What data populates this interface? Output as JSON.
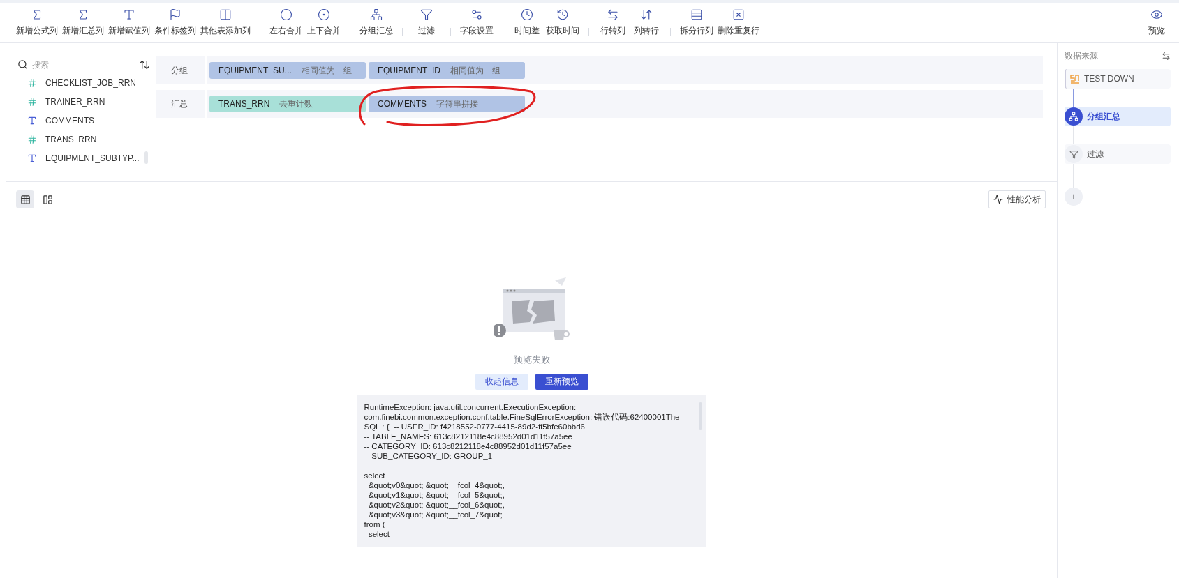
{
  "toolbar": {
    "groups": [
      [
        {
          "label": "新增公式列"
        },
        {
          "label": "新增汇总列"
        },
        {
          "label": "新增赋值列"
        },
        {
          "label": "条件标签列"
        },
        {
          "label": "其他表添加列"
        }
      ],
      [
        {
          "label": "左右合并"
        },
        {
          "label": "上下合并"
        }
      ],
      [
        {
          "label": "分组汇总"
        }
      ],
      [
        {
          "label": "过滤"
        }
      ],
      [
        {
          "label": "字段设置"
        }
      ],
      [
        {
          "label": "时间差"
        },
        {
          "label": "获取时间"
        }
      ],
      [
        {
          "label": "行转列"
        },
        {
          "label": "列转行"
        }
      ],
      [
        {
          "label": "拆分行列"
        },
        {
          "label": "删除重复行"
        }
      ]
    ],
    "preview": {
      "label": "预览"
    }
  },
  "fields": {
    "search": {
      "placeholder": "搜索"
    },
    "items": [
      {
        "name": "CHECKLIST_JOB_RRN",
        "kind": "number"
      },
      {
        "name": "TRAINER_RRN",
        "kind": "number"
      },
      {
        "name": "COMMENTS",
        "kind": "text"
      },
      {
        "name": "TRANS_RRN",
        "kind": "number"
      },
      {
        "name": "EQUIPMENT_SUBTYP...",
        "kind": "text"
      }
    ]
  },
  "config": [
    {
      "label": "分组",
      "tags": [
        {
          "field": "EQUIPMENT_SU...",
          "method": "相同值为一组",
          "color": "#b0c3e5"
        },
        {
          "field": "EQUIPMENT_ID",
          "method": "相同值为一组",
          "color": "#b0c3e5"
        }
      ]
    },
    {
      "label": "汇总",
      "tags": [
        {
          "field": "TRANS_RRN",
          "method": "去重计数",
          "color": "#a8e0d8"
        },
        {
          "field": "COMMENTS",
          "method": "字符串拼接",
          "color": "#b0c3e5"
        }
      ]
    }
  ],
  "preview": {
    "views": [
      {
        "selected": true
      },
      {
        "selected": false
      }
    ],
    "perf_button": "性能分析",
    "status": "预览失败",
    "collapse_button": "收起信息",
    "retry_button": "重新预览",
    "error_lines": [
      "RuntimeException: java.util.concurrent.ExecutionException:",
      "com.finebi.common.exception.conf.table.FineSqlErrorException: 错误代码:62400001The",
      "SQL : {  -- USER_ID: f4218552-0777-4415-89d2-ff5bfe60bbd6",
      "-- TABLE_NAMES: 613c8212118e4c88952d01d11f57a5ee",
      "-- CATEGORY_ID: 613c8212118e4c88952d01d11f57a5ee",
      "-- SUB_CATEGORY_ID: GROUP_1"
    ],
    "sql_lines": [
      "select",
      "  &quot;v0&quot; &quot;__fcol_4&quot;,",
      "  &quot;v1&quot; &quot;__fcol_5&quot;,",
      "  &quot;v2&quot; &quot;__fcol_6&quot;,",
      "  &quot;v3&quot; &quot;__fcol_7&quot;",
      "from (",
      "  select"
    ]
  },
  "steps_panel": {
    "title": "数据来源",
    "steps": [
      {
        "label": "TEST DOWN",
        "kind": "source",
        "selected": false
      },
      {
        "label": "分组汇总",
        "kind": "group",
        "selected": true
      },
      {
        "label": "过滤",
        "kind": "filter",
        "selected": false
      }
    ],
    "add_button": "+"
  }
}
